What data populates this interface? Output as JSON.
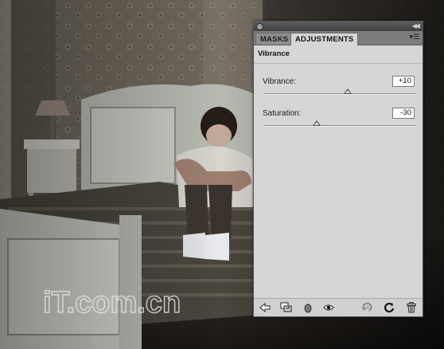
{
  "panel": {
    "tabs": [
      {
        "label": "MASKS",
        "active": false
      },
      {
        "label": "ADJUSTMENTS",
        "active": true
      }
    ],
    "title": "Vibrance",
    "controls": [
      {
        "label": "Vibrance:",
        "value": "+10",
        "min": -100,
        "max": 100,
        "current": 10
      },
      {
        "label": "Saturation:",
        "value": "-30",
        "min": -100,
        "max": 100,
        "current": -30
      }
    ],
    "footer_icons": [
      "back-arrow-icon",
      "clip-to-layer-icon",
      "layer-visibility-icon",
      "eye-icon",
      "view-previous-state-icon",
      "reset-icon",
      "trash-icon"
    ]
  },
  "watermark": {
    "text": "iT.com.cn"
  },
  "colors": {
    "panel_bg": "#d6d6d6",
    "tabbar_bg": "#7c7c7c",
    "titlebar_bg": "#4a4a4a"
  }
}
